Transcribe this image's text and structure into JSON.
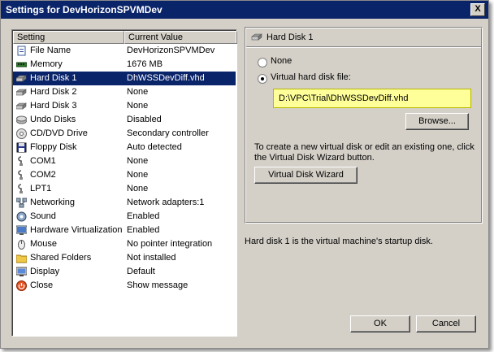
{
  "window": {
    "title": "Settings for DevHorizonSPVMDev",
    "close_label": "X"
  },
  "list": {
    "header_setting": "Setting",
    "header_value": "Current Value",
    "rows": [
      {
        "setting": "File Name",
        "value": "DevHorizonSPVMDev",
        "icon": "file-icon"
      },
      {
        "setting": "Memory",
        "value": "1676 MB",
        "icon": "memory-icon"
      },
      {
        "setting": "Hard Disk 1",
        "value": "DhWSSDevDiff.vhd",
        "icon": "hard-disk-icon",
        "selected": true
      },
      {
        "setting": "Hard Disk 2",
        "value": "None",
        "icon": "hard-disk-icon"
      },
      {
        "setting": "Hard Disk 3",
        "value": "None",
        "icon": "hard-disk-icon"
      },
      {
        "setting": "Undo Disks",
        "value": "Disabled",
        "icon": "undo-disks-icon"
      },
      {
        "setting": "CD/DVD Drive",
        "value": "Secondary controller",
        "icon": "cd-dvd-icon"
      },
      {
        "setting": "Floppy Disk",
        "value": "Auto detected",
        "icon": "floppy-icon"
      },
      {
        "setting": "COM1",
        "value": "None",
        "icon": "serial-port-icon"
      },
      {
        "setting": "COM2",
        "value": "None",
        "icon": "serial-port-icon"
      },
      {
        "setting": "LPT1",
        "value": "None",
        "icon": "parallel-port-icon"
      },
      {
        "setting": "Networking",
        "value": "Network adapters:1",
        "icon": "network-icon"
      },
      {
        "setting": "Sound",
        "value": "Enabled",
        "icon": "sound-icon"
      },
      {
        "setting": "Hardware Virtualization",
        "value": "Enabled",
        "icon": "hardware-virtualization-icon"
      },
      {
        "setting": "Mouse",
        "value": "No pointer integration",
        "icon": "mouse-icon"
      },
      {
        "setting": "Shared Folders",
        "value": "Not installed",
        "icon": "shared-folder-icon"
      },
      {
        "setting": "Display",
        "value": "Default",
        "icon": "display-icon"
      },
      {
        "setting": "Close",
        "value": "Show message",
        "icon": "close-power-icon"
      }
    ]
  },
  "panel": {
    "title": "Hard Disk 1",
    "option_none": "None",
    "option_file": "Virtual hard disk file:",
    "selected_option": "file",
    "file_path": "D:\\VPC\\Trial\\DhWSSDevDiff.vhd",
    "browse_label": "Browse...",
    "help_text": "To create a new virtual disk or edit an existing one, click the Virtual Disk Wizard button.",
    "wizard_label": "Virtual Disk Wizard"
  },
  "startup_note": "Hard disk 1 is the virtual machine's startup disk.",
  "buttons": {
    "ok": "OK",
    "cancel": "Cancel"
  },
  "colors": {
    "selection": "#0a246a",
    "dialog_bg": "#d4d0c8",
    "path_highlight": "#ffff99"
  }
}
